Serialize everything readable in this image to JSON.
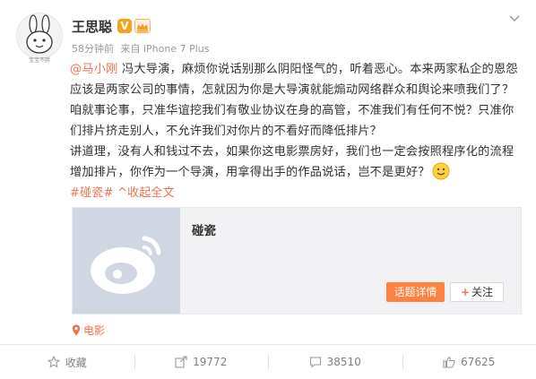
{
  "post": {
    "avatar_caption": "宝宝不胖",
    "username": "王思聪",
    "verified_badge": "V",
    "badge_icons": [
      "verified-v-icon",
      "vip-crown-icon"
    ],
    "time": "58分钟前",
    "source": "来自 iPhone 7 Plus",
    "mention": "@马小刚",
    "body_line_1": " 冯大导演，麻烦你说话别那么阴阳怪气的，听着恶心。本来两家私企的恩怨应该是两家公司的事情，怎就因为你是大导演就能煽动网络群众和舆论来喷我们了？咱就事论事，只准华谊挖我们有敬业协议在身的高管，不准我们有任何不悦？只准你们排片挤走别人，不允许我们对你片的不看好而降低排片？",
    "body_line_2": "讲道理，没有人和钱过不去，如果你这电影票房好，我们也一定会按照程序化的流程增加排片，你作为一个导演，用拿得出手的作品说话，岂不是更好？",
    "emoji": "smile-icon",
    "hashtag": "#碰瓷#",
    "collapse_label": "收起全文",
    "collapse_arrow": "^"
  },
  "topic_card": {
    "title": "碰瓷",
    "detail_button": "话题详情",
    "follow_plus": "+",
    "follow_button": "关注"
  },
  "location": {
    "icon": "location-pin-icon",
    "label": "电影"
  },
  "actions": [
    {
      "icon": "star-icon",
      "label": "收藏"
    },
    {
      "icon": "share-icon",
      "label": "19772"
    },
    {
      "icon": "comment-icon",
      "label": "38510"
    },
    {
      "icon": "like-icon",
      "label": "67625"
    }
  ],
  "colors": {
    "accent": "#eb7350",
    "button_orange": "#ff8140",
    "badge_orange": "#f8a21a"
  }
}
